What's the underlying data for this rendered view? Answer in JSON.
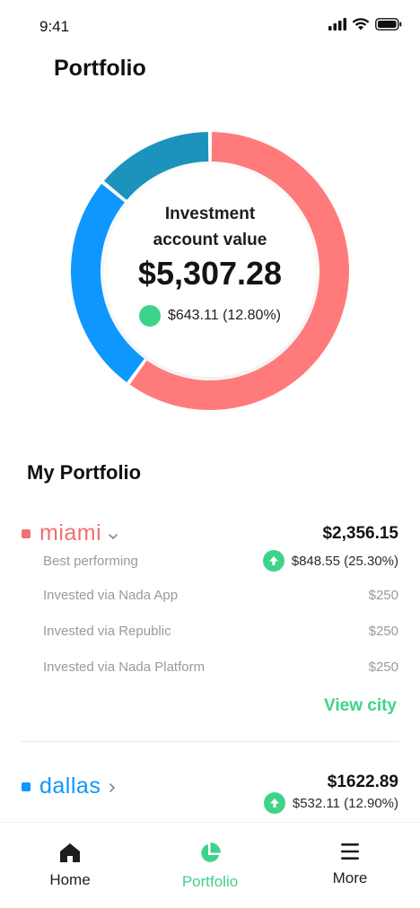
{
  "status": {
    "time": "9:41"
  },
  "header": {
    "title": "Portfolio"
  },
  "summary": {
    "label_line1": "Investment",
    "label_line2": "account value",
    "value": "$5,307.28",
    "change": "$643.11 (12.80%)"
  },
  "donut": {
    "segments": [
      {
        "city": "miami",
        "fraction": 0.6,
        "color": "#ff7b7b"
      },
      {
        "city": "dallas",
        "fraction": 0.26,
        "color": "#0d97ff"
      },
      {
        "city": "other",
        "fraction": 0.14,
        "color": "#1b93bc"
      }
    ]
  },
  "section_title": "My Portfolio",
  "cities": [
    {
      "name": "miami",
      "color": "#f27070",
      "total": "$2,356.15",
      "best_label": "Best performing",
      "change": "$848.55 (25.30%)",
      "details": [
        {
          "label": "Invested via Nada App",
          "amount": "$250"
        },
        {
          "label": "Invested via Republic",
          "amount": "$250"
        },
        {
          "label": "Invested via Nada Platform",
          "amount": "$250"
        }
      ],
      "view_label": "View city"
    },
    {
      "name": "dallas",
      "color": "#0d97ff",
      "total": "$1622.89",
      "change": "$532.11 (12.90%)"
    }
  ],
  "nav": [
    {
      "label": "Home",
      "icon": "home-icon"
    },
    {
      "label": "Portfolio",
      "icon": "pie-chart-icon"
    },
    {
      "label": "More",
      "icon": "menu-icon"
    }
  ],
  "colors": {
    "accent": "#3ed38a",
    "miami": "#ff7b7b",
    "dallas": "#0d97ff",
    "teal": "#1b93bc"
  }
}
